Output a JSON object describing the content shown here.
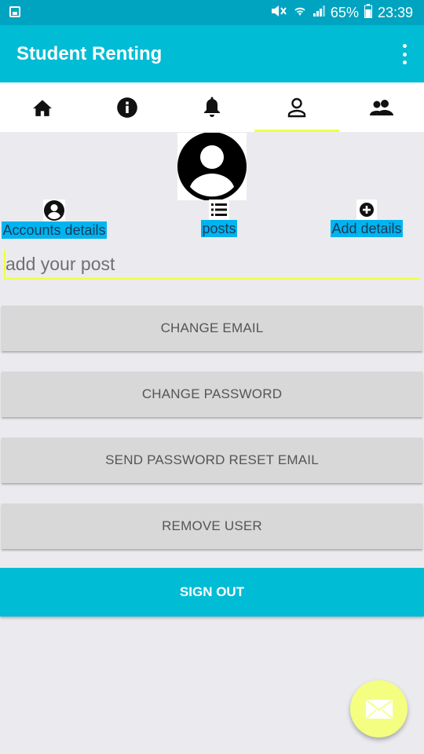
{
  "status_bar": {
    "battery_percent": "65%",
    "time": "23:39"
  },
  "app_bar": {
    "title": "Student Renting"
  },
  "tabs": [
    {
      "icon": "home-icon"
    },
    {
      "icon": "info-icon"
    },
    {
      "icon": "bell-icon"
    },
    {
      "icon": "person-icon",
      "active": true
    },
    {
      "icon": "people-icon"
    }
  ],
  "profile": {
    "shortcuts": [
      {
        "label": "Accounts details",
        "icon": "account-circle-icon"
      },
      {
        "label": "posts",
        "icon": "list-icon"
      },
      {
        "label": "Add details",
        "icon": "add-circle-icon"
      }
    ],
    "post_input_placeholder": "add your post"
  },
  "actions": {
    "change_email": "CHANGE EMAIL",
    "change_password": "CHANGE PASSWORD",
    "send_reset": "SEND PASSWORD RESET EMAIL",
    "remove_user": "REMOVE USER",
    "sign_out": "SIGN OUT"
  },
  "colors": {
    "primary": "#00bcd4",
    "primary_dark": "#00a4c0",
    "accent": "#eeff41",
    "label_bg": "#00b4ef",
    "fab": "#f4ff81"
  }
}
